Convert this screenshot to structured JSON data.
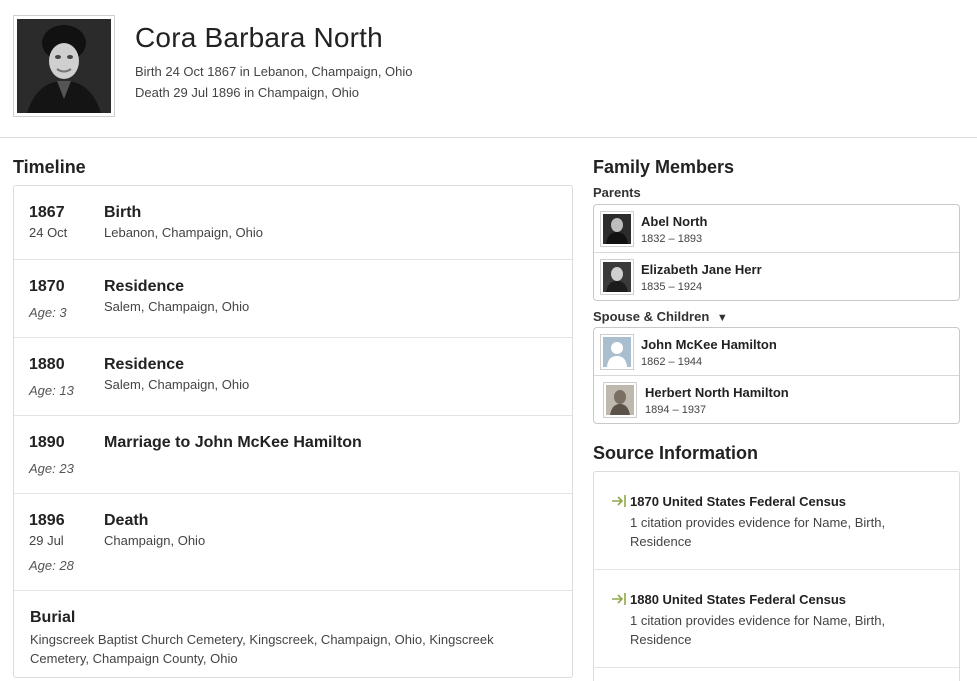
{
  "person": {
    "name": "Cora Barbara North",
    "birth_line": "Birth 24 Oct 1867 in Lebanon, Champaign, Ohio",
    "death_line": "Death 29 Jul 1896 in Champaign, Ohio"
  },
  "timeline": {
    "title": "Timeline",
    "items": [
      {
        "year": "1867",
        "date": "24 Oct",
        "age": "",
        "event": "Birth",
        "place": "Lebanon, Champaign, Ohio"
      },
      {
        "year": "1870",
        "date": "",
        "age": "Age: 3",
        "event": "Residence",
        "place": "Salem, Champaign, Ohio"
      },
      {
        "year": "1880",
        "date": "",
        "age": "Age: 13",
        "event": "Residence",
        "place": "Salem, Champaign, Ohio"
      },
      {
        "year": "1890",
        "date": "",
        "age": "Age: 23",
        "event": "Marriage to John McKee Hamilton",
        "place": ""
      },
      {
        "year": "1896",
        "date": "29 Jul",
        "age": "Age: 28",
        "event": "Death",
        "place": "Champaign, Ohio"
      }
    ],
    "burial": {
      "title": "Burial",
      "place": "Kingscreek Baptist Church Cemetery, Kingscreek, Champaign, Ohio, Kingscreek Cemetery, Champaign County, Ohio"
    }
  },
  "family": {
    "title": "Family Members",
    "parents_label": "Parents",
    "parents": [
      {
        "name": "Abel North",
        "dates": "1832 – 1893",
        "thumb": "portrait-photo"
      },
      {
        "name": "Elizabeth Jane Herr",
        "dates": "1835 – 1924",
        "thumb": "portrait-photo"
      }
    ],
    "spouse_label": "Spouse & Children",
    "spouse_toggle": "▼",
    "spouse_children": [
      {
        "name": "John McKee Hamilton",
        "dates": "1862 – 1944",
        "thumb": "silhouette-icon"
      },
      {
        "name": "Herbert North Hamilton",
        "dates": "1894 – 1937",
        "thumb": "portrait-photo"
      }
    ]
  },
  "sources": {
    "title": "Source Information",
    "icon": "→",
    "items": [
      {
        "title": "1870 United States Federal Census",
        "desc": "1 citation provides evidence for Name, Birth, Residence"
      },
      {
        "title": "1880 United States Federal Census",
        "desc": "1 citation provides evidence for Name, Birth, Residence"
      }
    ]
  },
  "colors": {
    "source_icon": "#8fa84a",
    "border": "#dcdcdc"
  }
}
